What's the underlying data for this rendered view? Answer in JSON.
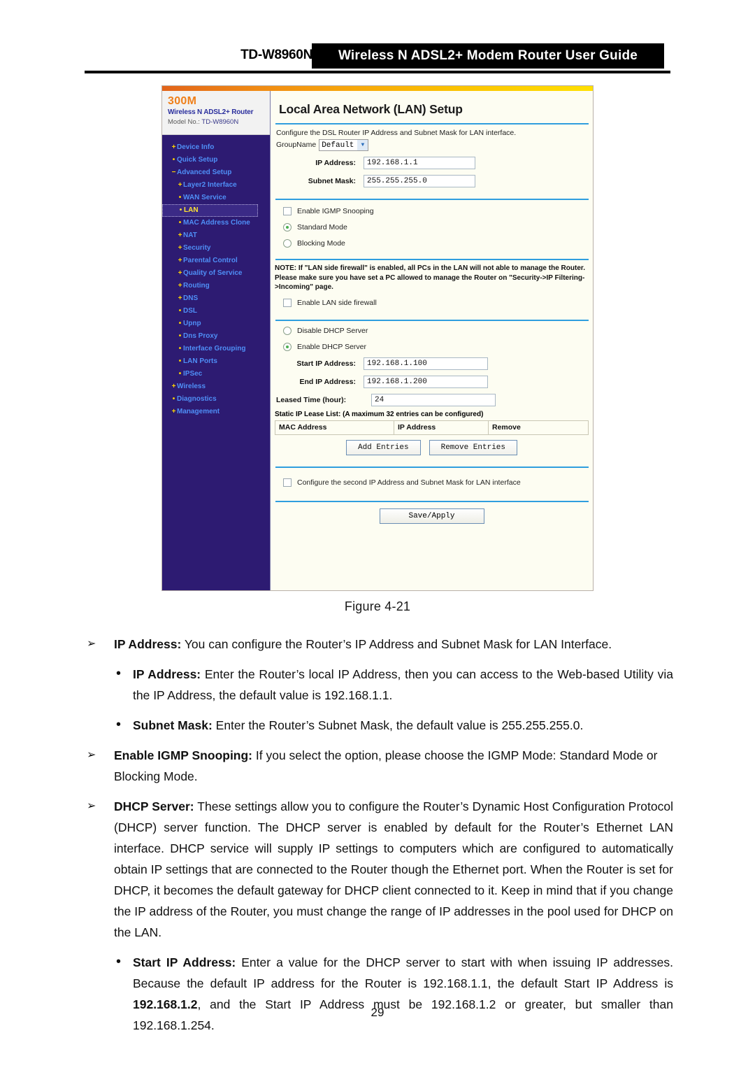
{
  "header": {
    "model": "TD-W8960N",
    "title": "Wireless N ADSL2+ Modem Router User Guide"
  },
  "router_ui": {
    "brand": {
      "speed": "300M",
      "product": "Wireless N ADSL2+ Router",
      "model_label": "Model No.:",
      "model_value": "TD-W8960N"
    },
    "menu": [
      {
        "label": "Device Info",
        "marker": "+",
        "level": 1,
        "selected": false
      },
      {
        "label": "Quick Setup",
        "marker": "•",
        "level": 1,
        "selected": false
      },
      {
        "label": "Advanced Setup",
        "marker": "−",
        "level": 1,
        "selected": false
      },
      {
        "label": "Layer2 Interface",
        "marker": "+",
        "level": 2,
        "selected": false
      },
      {
        "label": "WAN Service",
        "marker": "•",
        "level": 2,
        "selected": false
      },
      {
        "label": "LAN",
        "marker": "•",
        "level": 2,
        "selected": true
      },
      {
        "label": "MAC Address Clone",
        "marker": "•",
        "level": 2,
        "selected": false
      },
      {
        "label": "NAT",
        "marker": "+",
        "level": 2,
        "selected": false
      },
      {
        "label": "Security",
        "marker": "+",
        "level": 2,
        "selected": false
      },
      {
        "label": "Parental Control",
        "marker": "+",
        "level": 2,
        "selected": false
      },
      {
        "label": "Quality of Service",
        "marker": "+",
        "level": 2,
        "selected": false
      },
      {
        "label": "Routing",
        "marker": "+",
        "level": 2,
        "selected": false
      },
      {
        "label": "DNS",
        "marker": "+",
        "level": 2,
        "selected": false
      },
      {
        "label": "DSL",
        "marker": "•",
        "level": 2,
        "selected": false
      },
      {
        "label": "Upnp",
        "marker": "•",
        "level": 2,
        "selected": false
      },
      {
        "label": "Dns Proxy",
        "marker": "•",
        "level": 2,
        "selected": false
      },
      {
        "label": "Interface Grouping",
        "marker": "•",
        "level": 2,
        "selected": false
      },
      {
        "label": "LAN Ports",
        "marker": "•",
        "level": 2,
        "selected": false
      },
      {
        "label": "IPSec",
        "marker": "•",
        "level": 2,
        "selected": false
      },
      {
        "label": "Wireless",
        "marker": "+",
        "level": 1,
        "selected": false
      },
      {
        "label": "Diagnostics",
        "marker": "•",
        "level": 1,
        "selected": false
      },
      {
        "label": "Management",
        "marker": "+",
        "level": 1,
        "selected": false
      }
    ],
    "panel": {
      "title": "Local Area Network (LAN) Setup",
      "intro": "Configure the DSL Router IP Address and Subnet Mask for LAN interface.",
      "group_name_label": "GroupName",
      "group_name_value": "Default",
      "ip_address_label": "IP Address:",
      "ip_address_value": "192.168.1.1",
      "subnet_mask_label": "Subnet Mask:",
      "subnet_mask_value": "255.255.255.0",
      "igmp_checkbox_label": "Enable IGMP Snooping",
      "standard_mode_label": "Standard Mode",
      "blocking_mode_label": "Blocking Mode",
      "note_text": "NOTE: If \"LAN side firewall\" is enabled, all PCs in the LAN will not able to manage the Router. Please make sure you have set a PC allowed to manage the Router on \"Security->IP Filtering->Incoming\" page.",
      "lan_firewall_label": "Enable LAN side firewall",
      "disable_dhcp_label": "Disable DHCP Server",
      "enable_dhcp_label": "Enable DHCP Server",
      "start_ip_label": "Start IP Address:",
      "start_ip_value": "192.168.1.100",
      "end_ip_label": "End IP Address:",
      "end_ip_value": "192.168.1.200",
      "leased_time_label": "Leased Time (hour):",
      "leased_time_value": "24",
      "lease_list_title": "Static IP Lease List: (A maximum 32 entries can be configured)",
      "table_headers": [
        "MAC Address",
        "IP Address",
        "Remove"
      ],
      "add_entries_label": "Add Entries",
      "remove_entries_label": "Remove Entries",
      "second_ip_label": "Configure the second IP Address and Subnet Mask for LAN interface",
      "save_apply_label": "Save/Apply"
    }
  },
  "figure_caption": "Figure 4-21",
  "doc": {
    "b1_mark": "➢",
    "b1_title": "IP Address:",
    "b1_text": " You can configure the Router’s IP Address and Subnet Mask for LAN Interface.",
    "b2_mark": "•",
    "b2_title": "IP Address:",
    "b2_text": " Enter the Router’s local IP Address, then you can access to the Web-based Utility via the IP Address, the default value is 192.168.1.1.",
    "b3_mark": "•",
    "b3_title": "Subnet Mask:",
    "b3_text": " Enter the Router’s Subnet Mask, the default value is 255.255.255.0.",
    "b4_mark": "➢",
    "b4_title": "Enable IGMP Snooping:",
    "b4_text": " If you select the option, please choose the IGMP Mode: Standard Mode or Blocking Mode.",
    "b5_mark": "➢",
    "b5_title": "DHCP Server:",
    "b5_text": " These settings allow you to configure the Router’s Dynamic Host Configuration Protocol (DHCP) server function. The DHCP server is enabled by default for the Router’s Ethernet LAN interface. DHCP service will supply IP settings to computers which are configured to automatically obtain IP settings that are connected to the Router though the Ethernet port. When the Router is set for DHCP, it becomes the default gateway for DHCP client connected to it. Keep in mind that if you change the IP address of the Router, you must change the range of IP addresses in the pool used for DHCP on the LAN.",
    "b6_mark": "•",
    "b6_title": "Start IP Address:",
    "b6_text_1": " Enter a value for the DHCP server to start with when issuing IP addresses. Because the default IP address for the Router is 192.168.1.1, the default Start IP Address is ",
    "b6_bold_ip": "192.168.1.2",
    "b6_text_2": ", and the Start IP Address must be 192.168.1.2 or greater, but smaller than 192.168.1.254."
  },
  "page_number": "29"
}
